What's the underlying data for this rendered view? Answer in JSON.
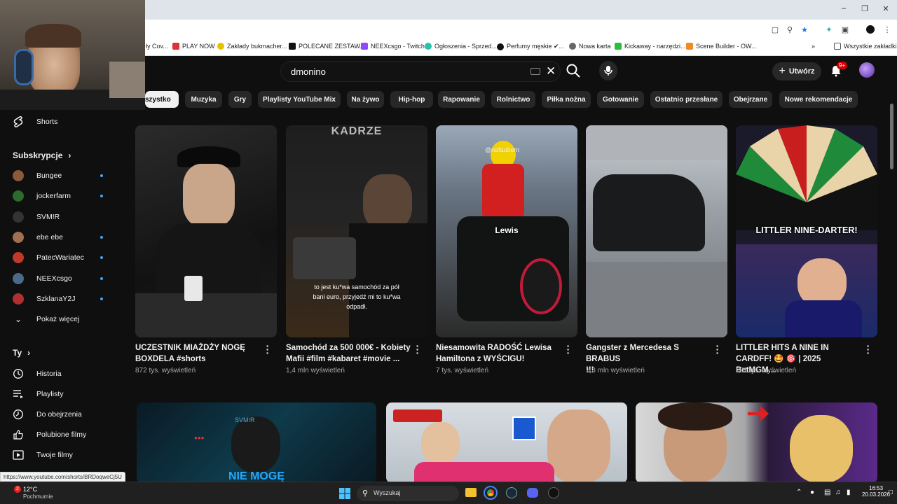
{
  "chrome": {
    "bookmarks": [
      {
        "label": "PLAY NOW",
        "icon": "red"
      },
      {
        "label": "Zakłady bukmacher...",
        "icon": "yellow"
      },
      {
        "label": "POLECANE ZESTAW...",
        "icon": "black"
      },
      {
        "label": "NEEXcsgo - Twitch",
        "icon": "purple"
      },
      {
        "label": "Ogłoszenia - Sprzed...",
        "icon": "teal"
      },
      {
        "label": "Perfumy męskie ✔...",
        "icon": "black"
      },
      {
        "label": "Nowa karta",
        "icon": "chrome"
      },
      {
        "label": "Kickaway - narzędzi...",
        "icon": "green"
      },
      {
        "label": "Scene Builder - OW...",
        "icon": "orange"
      }
    ],
    "bookmark_partial": "ły Cov...",
    "all_bookmarks": "Wszystkie zakładki"
  },
  "youtube": {
    "search_value": "dmonino",
    "create_label": "Utwórz",
    "notif_count": "9+",
    "chips": [
      "Wszystko",
      "Muzyka",
      "Gry",
      "Playlisty YouTube Mix",
      "Na żywo",
      "Hip-hop",
      "Rapowanie",
      "Rolnictwo",
      "Piłka nożna",
      "Gotowanie",
      "Ostatnio przesłane",
      "Obejrzane",
      "Nowe rekomendacje"
    ],
    "chips_display_first": "szystko"
  },
  "sidebar": {
    "shorts": "Shorts",
    "subs_header": "Subskrypcje",
    "subs": [
      {
        "name": "Bungee",
        "color": "#8a5a3a",
        "dot": true
      },
      {
        "name": "jockerfarm",
        "color": "#2d6a2d",
        "dot": true
      },
      {
        "name": "SVM!R",
        "color": "#222222",
        "dot": false
      },
      {
        "name": "ebe ebe",
        "color": "#a07050",
        "dot": true
      },
      {
        "name": "PatecWariatec",
        "color": "#c0392b",
        "dot": true
      },
      {
        "name": "NEEXcsgo",
        "color": "#4a6a8a",
        "dot": true
      },
      {
        "name": "SzklanaY2J",
        "color": "#b03030",
        "dot": true
      }
    ],
    "show_more": "Pokaż więcej",
    "you_header": "Ty",
    "you_items": [
      "Historia",
      "Playlisty",
      "Do obejrzenia",
      "Polubione filmy",
      "Twoje filmy"
    ]
  },
  "shorts": [
    {
      "title_line1": "UCZESTNIK MIAŻDŻY NOGĘ",
      "title_line2": "BOXDELA #shorts",
      "views": "872 tys. wyświetleń"
    },
    {
      "title_line1": "Samochód za 500 000€ - Kobiety",
      "title_line2": "Mafii  #film #kabaret #movie ...",
      "views": "1,4 mln wyświetleń",
      "overlay_top": "KADRZE",
      "caption_line1": "to jest ku*wa samochód za pół",
      "caption_line2": "bani euro, przyjedź mi to ku*wa",
      "caption_line3": "odpadł."
    },
    {
      "title_line1": "Niesamowita RADOŚĆ Lewisa",
      "title_line2": "Hamiltona z WYŚCIGU!",
      "views": "7 tys. wyświetleń",
      "overlay": "Lewis",
      "watermark": "@nafaubem"
    },
    {
      "title_line1": "Gangster z Mercedesa S BRABUS",
      "title_line2": "!!!",
      "views": "1,3 mln wyświetleń"
    },
    {
      "title_line1": "LITTLER HITS A NINE IN",
      "title_line2": "CARDFF! 🤩 🎯 | 2025 BetMGM...",
      "views": "661 tys. wyświetleń",
      "overlay": "LITTLER NINE-DARTER!"
    }
  ],
  "row2": {
    "first_overlay": "NIE MOGĘ",
    "first_tag": "SVM!R"
  },
  "status_url": "https://www.youtube.com/shorts/BRDoqweCj5U",
  "taskbar": {
    "weather_temp": "12°C",
    "weather_desc": "Pochmurnie",
    "weather_badge": "2",
    "search_placeholder": "Wyszukaj",
    "time": "16:53",
    "date": "20.03.2026"
  }
}
